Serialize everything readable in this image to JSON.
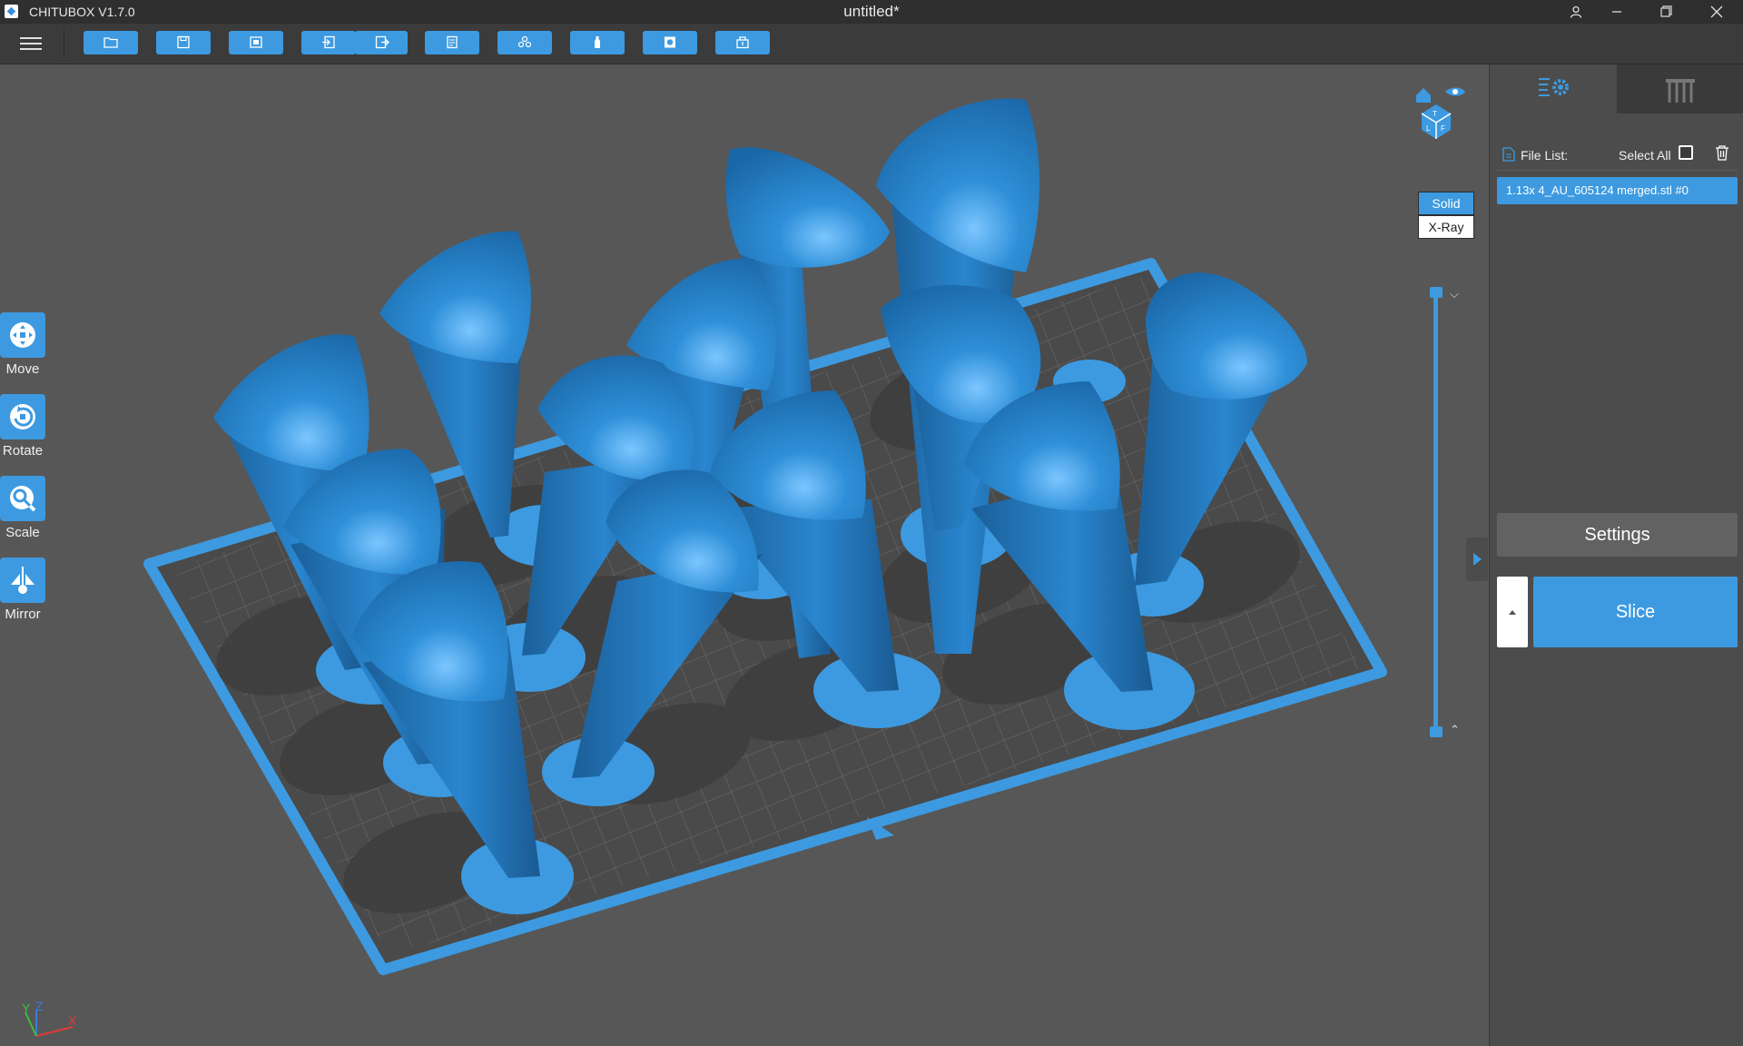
{
  "window": {
    "app_name": "CHITUBOX V1.7.0",
    "doc_title": "untitled*"
  },
  "toolbar": {
    "buttons": [
      "open-file",
      "save",
      "export-image",
      "import",
      "export",
      "print-list",
      "auto-support",
      "auto-support-single",
      "hollow",
      "punch-hole"
    ]
  },
  "tools": {
    "move": "Move",
    "rotate": "Rotate",
    "scale": "Scale",
    "mirror": "Mirror"
  },
  "view": {
    "solid": "Solid",
    "xray": "X-Ray",
    "active_mode": "Solid"
  },
  "axes": {
    "y": "Y",
    "z": "Z",
    "x": "X"
  },
  "panel": {
    "file_list_label": "File List:",
    "select_all_label": "Select All",
    "files": [
      "1.13x 4_AU_605124 merged.stl #0"
    ],
    "settings_label": "Settings",
    "slice_label": "Slice"
  },
  "colors": {
    "accent": "#3d9ae0",
    "model": "#2a86cf",
    "background": "#575757",
    "panel": "#4c4c4c"
  }
}
